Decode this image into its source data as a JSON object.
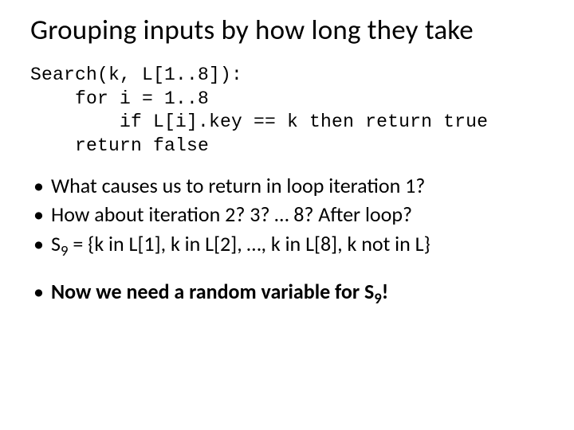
{
  "title": "Grouping inputs by how long they take",
  "code": {
    "l1": "Search(k, L[1..8]):",
    "l2": "    for i = 1..8",
    "l3": "        if L[i].key == k then return true",
    "l4": "    return false"
  },
  "bullets": {
    "b1": "What causes us to return in loop iteration 1?",
    "b2": "How about iteration 2?  3? … 8? After loop?",
    "b3_pre": "S",
    "b3_sub": "9",
    "b3_post": " = {k in L[1], k in L[2], …, k in L[8], k not in L}",
    "b4_pre": "Now we need a random variable for S",
    "b4_sub": "9",
    "b4_post": "!"
  }
}
